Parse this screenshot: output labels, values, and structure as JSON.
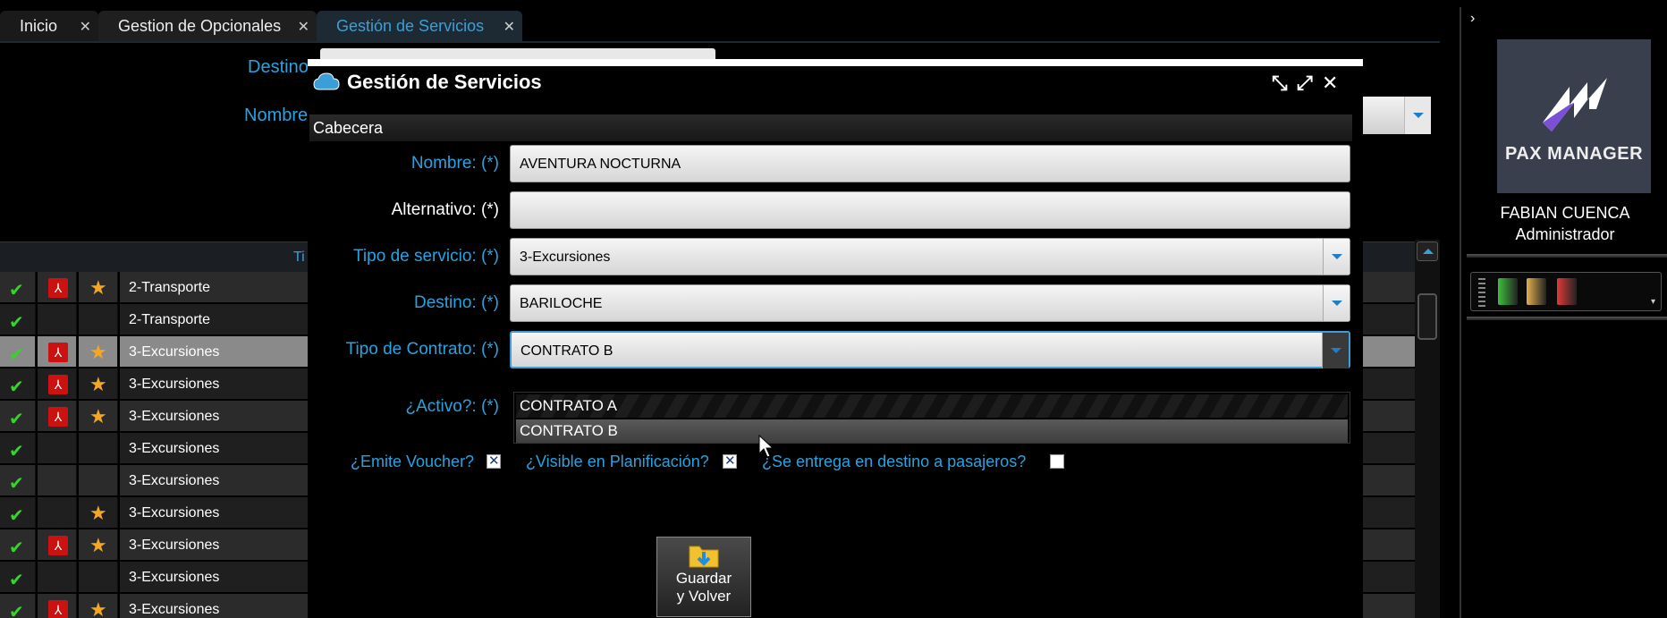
{
  "tabs": [
    {
      "label": "Inicio"
    },
    {
      "label": "Gestion de Opcionales"
    },
    {
      "label": "Gestión de Servicios"
    }
  ],
  "background": {
    "destino_label": "Destino",
    "nombre_label": "Nombre",
    "grid_header_ti": "Ti",
    "rows": [
      {
        "text": "2-Transporte",
        "pdf": true,
        "star": true
      },
      {
        "text": "2-Transporte",
        "pdf": false,
        "star": false
      },
      {
        "text": "3-Excursiones",
        "pdf": true,
        "star": true,
        "selected": true
      },
      {
        "text": "3-Excursiones",
        "pdf": true,
        "star": true
      },
      {
        "text": "3-Excursiones",
        "pdf": true,
        "star": true
      },
      {
        "text": "3-Excursiones",
        "pdf": false,
        "star": false
      },
      {
        "text": "3-Excursiones",
        "pdf": false,
        "star": false
      },
      {
        "text": "3-Excursiones",
        "pdf": false,
        "star": true
      },
      {
        "text": "3-Excursiones",
        "pdf": true,
        "star": true
      },
      {
        "text": "3-Excursiones",
        "pdf": false,
        "star": false
      },
      {
        "text": "3-Excursiones",
        "pdf": true,
        "star": true
      }
    ]
  },
  "sidebar": {
    "logo_text": "PAX MANAGER",
    "user_name": "FABIAN CUENCA",
    "user_role": "Administrador",
    "folder_colors": [
      "#3fbf3f",
      "#e0b050",
      "#e03a3a"
    ]
  },
  "modal": {
    "title": "Gestión de Servicios",
    "section": "Cabecera",
    "fields": {
      "nombre_label": "Nombre: (*)",
      "nombre_value": "AVENTURA NOCTURNA",
      "alternativo_label": "Alternativo: (*)",
      "alternativo_value": "",
      "tipo_servicio_label": "Tipo de servicio: (*)",
      "tipo_servicio_value": "3-Excursiones",
      "destino_label": "Destino: (*)",
      "destino_value": "BARILOCHE",
      "tipo_contrato_label": "Tipo de Contrato: (*)",
      "tipo_contrato_value": "CONTRATO B",
      "activo_label": "¿Activo?: (*)"
    },
    "dropdown_options": [
      "CONTRATO A",
      "CONTRATO B"
    ],
    "checks": {
      "emite_voucher_label": "¿Emite Voucher?",
      "emite_voucher": true,
      "visible_plan_label": "¿Visible en Planificación?",
      "visible_plan": true,
      "entrega_destino_label": "¿Se entrega en destino a pasajeros?",
      "entrega_destino": false
    },
    "save_label_1": "Guardar",
    "save_label_2": "y Volver"
  }
}
